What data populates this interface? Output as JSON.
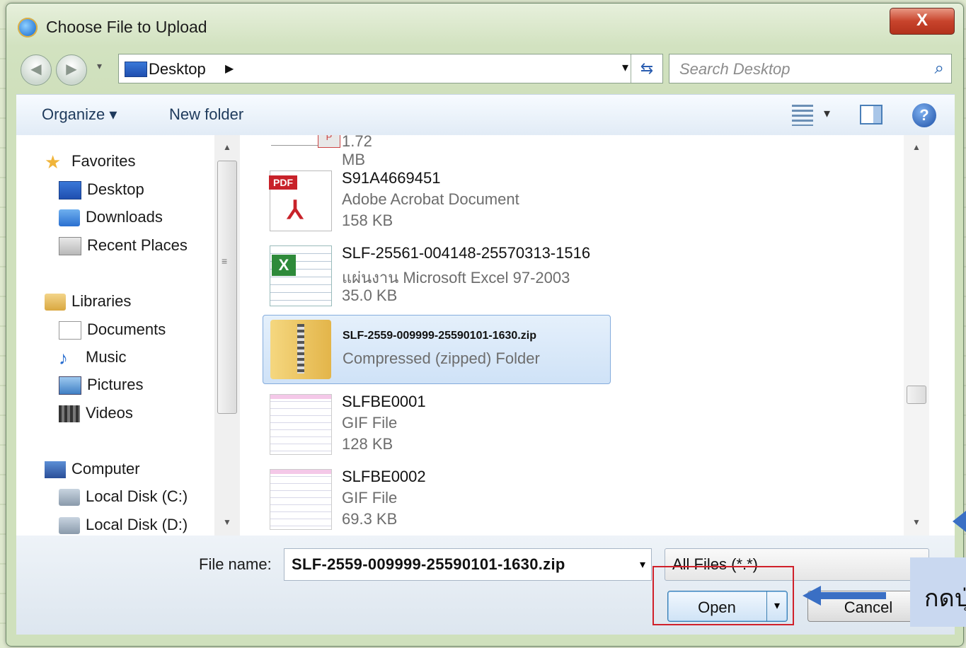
{
  "window": {
    "title": "Choose File to Upload",
    "close_label": "X"
  },
  "navbar": {
    "location": "Desktop",
    "search_placeholder": "Search Desktop"
  },
  "toolbar": {
    "organize": "Organize ▾",
    "new_folder": "New folder"
  },
  "sidebar": {
    "items": [
      {
        "label": "Favorites",
        "icon": "star-icon"
      },
      {
        "label": "Desktop",
        "icon": "desktop-icon"
      },
      {
        "label": "Downloads",
        "icon": "downloads-icon"
      },
      {
        "label": "Recent Places",
        "icon": "recent-places-icon"
      },
      {
        "label": "Libraries",
        "icon": "libraries-icon"
      },
      {
        "label": "Documents",
        "icon": "documents-icon"
      },
      {
        "label": "Music",
        "icon": "music-icon"
      },
      {
        "label": "Pictures",
        "icon": "pictures-icon"
      },
      {
        "label": "Videos",
        "icon": "videos-icon"
      },
      {
        "label": "Computer",
        "icon": "computer-icon"
      },
      {
        "label": "Local Disk (C:)",
        "icon": "local-disk-icon"
      },
      {
        "label": "Local Disk (D:)",
        "icon": "local-disk-icon"
      }
    ]
  },
  "files": {
    "partial_size": "1.72 MB",
    "items": [
      {
        "name": "S91A4669451",
        "type": "Adobe Acrobat Document",
        "size": "158 KB",
        "icon": "pdf-icon"
      },
      {
        "name": "SLF-25561-004148-25570313-1516",
        "type": "แผ่นงาน Microsoft Excel 97-2003",
        "size": "35.0 KB",
        "icon": "excel-icon"
      },
      {
        "name": "SLF-2559-009999-25590101-1630.zip",
        "type": "Compressed (zipped) Folder",
        "size": "",
        "icon": "zip-folder-icon",
        "selected": true
      },
      {
        "name": "SLFBE0001",
        "type": "GIF File",
        "size": "128 KB",
        "icon": "gif-thumbnail-icon"
      },
      {
        "name": "SLFBE0002",
        "type": "GIF File",
        "size": "69.3 KB",
        "icon": "gif-thumbnail-icon"
      }
    ]
  },
  "footer": {
    "file_name_label": "File name:",
    "file_name_value": "SLF-2559-009999-25590101-1630.zip",
    "filter_value": "All Files (*.*)",
    "open_label": "Open",
    "cancel_label": "Cancel"
  },
  "annotation": {
    "callout_text": "กดปุ่ม",
    "highlight_color": "#d0202a",
    "arrow_color": "#3a6fc4"
  }
}
